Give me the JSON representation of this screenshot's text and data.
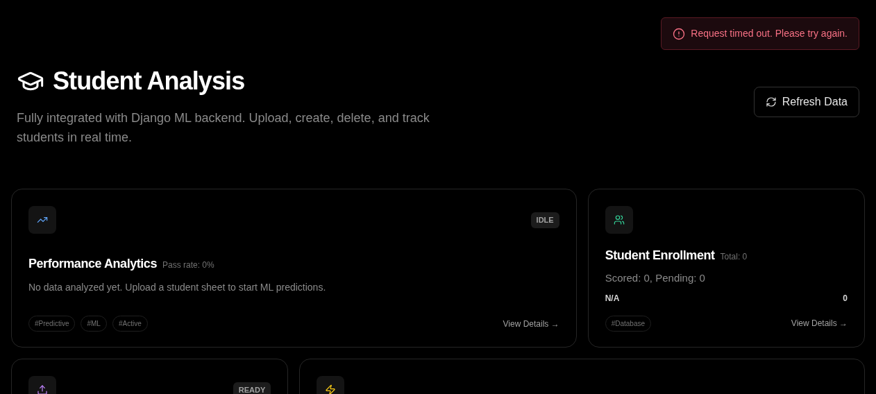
{
  "toast": {
    "kind": "error",
    "message": "Request timed out. Please try again."
  },
  "header": {
    "title": "Student Analysis",
    "description": "Fully integrated with Django ML backend. Upload, create, delete, and track students in real time.",
    "refresh_button": "Refresh Data"
  },
  "cards": [
    {
      "kind": "analytics",
      "badge": "IDLE",
      "title": "Performance Analytics",
      "subtitle": "Pass rate: 0%",
      "description": "No data analyzed yet. Upload a student sheet to start ML predictions.",
      "tags": [
        "#Predictive",
        "#ML",
        "#Active"
      ],
      "link": "View Details →"
    },
    {
      "kind": "enrollment",
      "title": "Student Enrollment",
      "subtitle": "Total: 0",
      "description": "Scored: 0, Pending: 0",
      "stat": {
        "label": "N/A",
        "value": "0"
      },
      "tags": [
        "#Database"
      ],
      "link": "View Details →"
    },
    {
      "kind": "upload",
      "badge": "READY"
    },
    {
      "kind": "action"
    }
  ]
}
